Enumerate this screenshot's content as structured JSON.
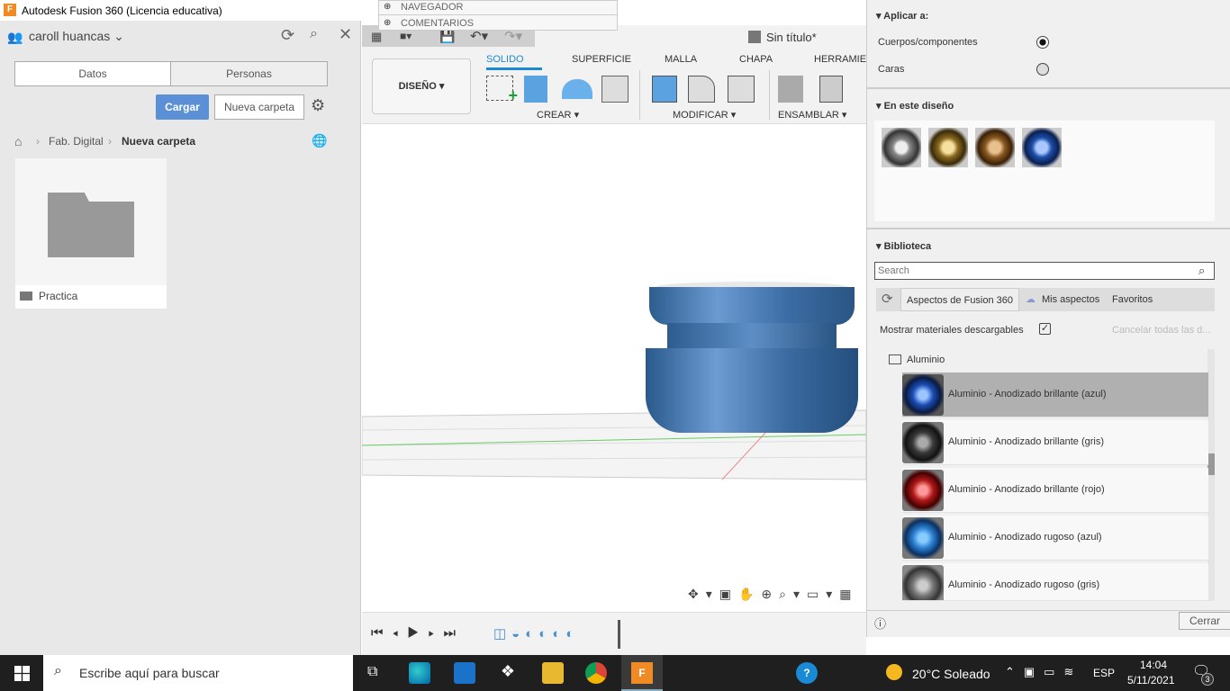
{
  "window": {
    "title": "Autodesk Fusion 360 (Licencia educativa)",
    "logo": "F"
  },
  "left": {
    "user": "caroll huancas",
    "tabs": [
      "Datos",
      "Personas"
    ],
    "upload": "Cargar",
    "new_folder": "Nueva carpeta",
    "breadcrumb": [
      "Fab. Digital",
      "Nueva carpeta"
    ],
    "folder": "Practica"
  },
  "menu": {
    "items": [
      "NAVEGADOR",
      "COMENTARIOS"
    ]
  },
  "toolbar": {
    "doc_title": "Sin título*",
    "workspace": "DISEÑO",
    "tabs": [
      "SOLIDO",
      "SUPERFICIE",
      "MALLA",
      "CHAPA",
      "HERRAMIEN"
    ],
    "groups": [
      "CREAR",
      "MODIFICAR",
      "ENSAMBLAR"
    ]
  },
  "right": {
    "apply_title": "Aplicar a:",
    "apply_options": [
      {
        "label": "Cuerpos/componentes",
        "selected": true
      },
      {
        "label": "Caras",
        "selected": false
      }
    ],
    "in_design_title": "En este diseño",
    "in_design_colors": [
      "#8a8a8a",
      "#8a6a20",
      "#8a5a20",
      "#1d4fa8"
    ],
    "library_title": "Biblioteca",
    "search_placeholder": "Search",
    "lib_tabs": [
      "Aspectos de Fusion 360",
      "Mis aspectos",
      "Favoritos"
    ],
    "show_downloadable": "Mostrar materiales descargables",
    "show_downloadable_checked": true,
    "cancel_all": "Cancelar todas las d...",
    "folder": "Aluminio",
    "materials": [
      {
        "label": "Aluminio - Anodizado brillante (azul)",
        "color": "#1a4db5",
        "selected": true
      },
      {
        "label": "Aluminio - Anodizado brillante (gris)",
        "color": "#3a3a3a",
        "selected": false
      },
      {
        "label": "Aluminio - Anodizado brillante (rojo)",
        "color": "#b01818",
        "selected": false
      },
      {
        "label": "Aluminio - Anodizado rugoso (azul)",
        "color": "#2a7ed0",
        "selected": false
      },
      {
        "label": "Aluminio - Anodizado rugoso (gris)",
        "color": "#777777",
        "selected": false
      }
    ],
    "close": "Cerrar"
  },
  "taskbar": {
    "search": "Escribe aquí para buscar",
    "weather": "20°C  Soleado",
    "lang": "ESP",
    "time": "14:04",
    "date": "5/11/2021",
    "notifications": "3"
  }
}
